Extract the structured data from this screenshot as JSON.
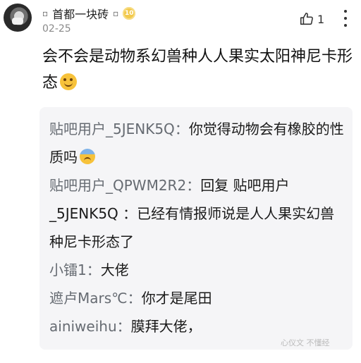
{
  "post": {
    "username": "首都一块砖",
    "username_deco": "▫",
    "level": "10",
    "date": "02-25",
    "like_count": "1",
    "text": "会不会是动物系幻兽种人人果实太阳神尼卡形态",
    "emoji": "smile-emoji"
  },
  "replies": [
    {
      "user": "贴吧用户_5JENK5Q",
      "sep": "：",
      "text": "你觉得动物会有橡胶的性质吗",
      "emoji": "sweat-emoji"
    },
    {
      "user": "贴吧用户_QPWM2R2",
      "sep": "：",
      "text": "回复  贴吧用户_5JENK5Q ：已经有情报师说是人人果实幻兽种尼卡形态了"
    },
    {
      "user": "小镭1",
      "sep": "：",
      "text": "大佬"
    },
    {
      "user": "遮卢Mars℃",
      "sep": "：",
      "text": "你才是尾田"
    },
    {
      "user": "ainiweihu",
      "sep": "：",
      "text": "膜拜大佬，"
    }
  ],
  "watermark": "心仪文 不懂经"
}
